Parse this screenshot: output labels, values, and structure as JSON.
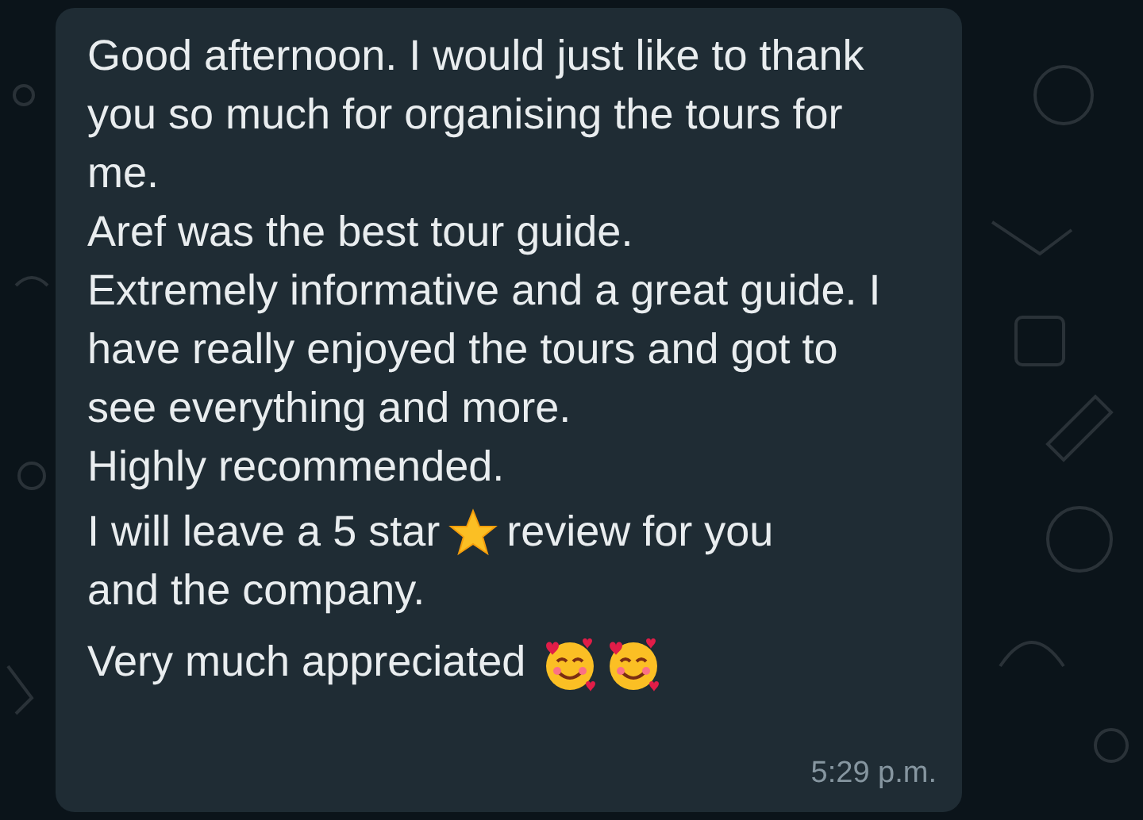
{
  "message": {
    "paragraphs": [
      {
        "kind": "text",
        "text": "Good afternoon. I would just like to thank you so much for organising the tours for me."
      },
      {
        "kind": "text",
        "text": "Aref was the best tour guide."
      },
      {
        "kind": "text",
        "text": "Extremely informative and a great guide. I have really enjoyed the tours and got to see everything and more."
      },
      {
        "kind": "text",
        "text": "Highly recommended."
      },
      {
        "kind": "with_star",
        "before": "I will leave a 5 star",
        "after": "review for you"
      },
      {
        "kind": "text",
        "text": "and the company."
      },
      {
        "kind": "with_faces",
        "before": "Very much appreciated"
      }
    ],
    "time": "5:29 p.m."
  }
}
